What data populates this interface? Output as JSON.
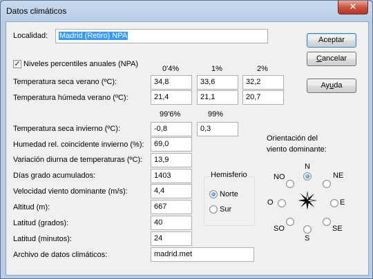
{
  "window": {
    "title": "Datos climáticos",
    "close_glyph": "✕"
  },
  "localidad": {
    "label": "Localidad:",
    "value": "Madrid (Retiro) NPA"
  },
  "buttons": {
    "aceptar": "Aceptar",
    "cancelar_pre": "C",
    "cancelar_rest": "ancelar",
    "ayuda_pre": "Ay",
    "ayuda_u": "u",
    "ayuda_rest": "da"
  },
  "niveles": {
    "label": "Niveles percentiles anuales (NPA)",
    "checked": true,
    "check_glyph": "✓"
  },
  "summer_headers": [
    "0'4%",
    "1%",
    "2%"
  ],
  "temp_seca_verano": {
    "label": "Temperatura seca verano (ºC):",
    "values": [
      "34,8",
      "33,6",
      "32,2"
    ]
  },
  "temp_humeda_verano": {
    "label": "Temperatura húmeda verano (ºC):",
    "values": [
      "21,4",
      "21,1",
      "20,7"
    ]
  },
  "winter_headers": [
    "99'6%",
    "99%"
  ],
  "temp_seca_invierno": {
    "label": "Temperatura seca invierno (ºC):",
    "values": [
      "-0,8",
      "0,3"
    ]
  },
  "humedad": {
    "label": "Humedad rel. coincidente invierno (%):",
    "value": "69,0"
  },
  "variacion": {
    "label": "Variación diurna de temperaturas (ºC):",
    "value": "13,9"
  },
  "dias_grado": {
    "label": "Días grado acumulados:",
    "value": "1403"
  },
  "velocidad": {
    "label": "Velocidad viento dominante (m/s):",
    "value": "4,4"
  },
  "altitud": {
    "label": "Altitud (m):",
    "value": "667"
  },
  "latitud_grados": {
    "label": "Latitud (grados):",
    "value": "40"
  },
  "latitud_minutos": {
    "label": "Latitud (minutos):",
    "value": "24"
  },
  "archivo": {
    "label": "Archivo de datos climáticos:",
    "value": "madrid.met"
  },
  "hemisferio": {
    "title": "Hemisferio",
    "norte": "Norte",
    "sur": "Sur",
    "selected": "Norte"
  },
  "orientacion": {
    "title_line1": "Orientación del",
    "title_line2": "viento dominante:",
    "selected": "N",
    "dirs": {
      "N": "N",
      "NE": "NE",
      "E": "E",
      "SE": "SE",
      "S": "S",
      "SO": "SO",
      "O": "O",
      "NO": "NO"
    }
  }
}
